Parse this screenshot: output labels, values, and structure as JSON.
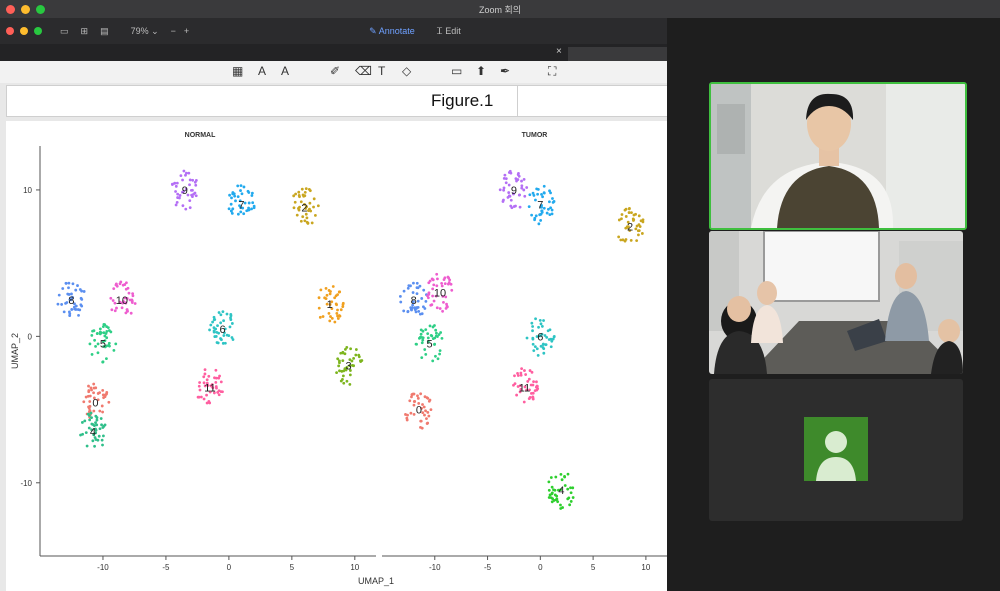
{
  "window": {
    "title": "Zoom 회의"
  },
  "toolbar": {
    "zoom_level": "79%",
    "annotate_label": "Annotate",
    "edit_label": "Edit"
  },
  "tab": {
    "close_glyph": "×"
  },
  "markup_icons": [
    "text-select-icon",
    "text-box-icon",
    "text-style-icon",
    "pen-icon",
    "eraser-icon",
    "text-icon",
    "shape-icon",
    "note-icon",
    "stamp-icon",
    "signature-icon",
    "fullscreen-icon"
  ],
  "figure": {
    "title": "Figure.1"
  },
  "chart_data": {
    "type": "scatter",
    "panels": [
      {
        "title": "NORMAL",
        "clusters": [
          {
            "label": "0",
            "color": "#f07a6f",
            "x": -10.6,
            "y": -4.5
          },
          {
            "label": "1",
            "color": "#f0a020",
            "x": 8.0,
            "y": 2.2
          },
          {
            "label": "2",
            "color": "#c9a620",
            "x": 6.0,
            "y": 8.8
          },
          {
            "label": "3",
            "color": "#7db51e",
            "x": 9.5,
            "y": -2.0
          },
          {
            "label": "4",
            "color": "#2fbf8a",
            "x": -10.8,
            "y": -6.5
          },
          {
            "label": "5",
            "color": "#2ecf86",
            "x": -10.0,
            "y": -0.5
          },
          {
            "label": "6",
            "color": "#2ec4c4",
            "x": -0.5,
            "y": 0.5
          },
          {
            "label": "7",
            "color": "#22aaee",
            "x": 1.0,
            "y": 9.0
          },
          {
            "label": "8",
            "color": "#5b8ff0",
            "x": -12.5,
            "y": 2.5
          },
          {
            "label": "9",
            "color": "#b46ff5",
            "x": -3.5,
            "y": 10.0
          },
          {
            "label": "10",
            "color": "#ee5ecf",
            "x": -8.5,
            "y": 2.5
          },
          {
            "label": "11",
            "color": "#ff5fa0",
            "x": -1.5,
            "y": -3.5
          }
        ]
      },
      {
        "title": "TUMOR",
        "clusters": [
          {
            "label": "0",
            "color": "#f07a6f",
            "x": -11.5,
            "y": -5.0
          },
          {
            "label": "2",
            "color": "#c9a620",
            "x": 8.5,
            "y": 7.5
          },
          {
            "label": "4",
            "color": "#2ecf2e",
            "x": 2.0,
            "y": -10.5
          },
          {
            "label": "5",
            "color": "#2ecf86",
            "x": -10.5,
            "y": -0.5
          },
          {
            "label": "6",
            "color": "#2ec4c4",
            "x": 0.0,
            "y": 0.0
          },
          {
            "label": "7",
            "color": "#22aaee",
            "x": 0.0,
            "y": 9.0
          },
          {
            "label": "8",
            "color": "#5b8ff0",
            "x": -12.0,
            "y": 2.5
          },
          {
            "label": "9",
            "color": "#b46ff5",
            "x": -2.5,
            "y": 10.0
          },
          {
            "label": "10",
            "color": "#ee5ecf",
            "x": -9.5,
            "y": 3.0
          },
          {
            "label": "11",
            "color": "#ff5fa0",
            "x": -1.5,
            "y": -3.5
          }
        ]
      }
    ],
    "xlabel": "UMAP_1",
    "ylabel": "UMAP_2",
    "xticks": [
      "-10",
      "-5",
      "0",
      "5",
      "10"
    ],
    "yticks": [
      "10",
      "0",
      "-10"
    ],
    "xlim": [
      -15,
      12
    ],
    "ylim": [
      -15,
      13
    ]
  },
  "participants": [
    {
      "kind": "video",
      "active_speaker": true,
      "accent": "#3fbf3f"
    },
    {
      "kind": "video",
      "active_speaker": false
    },
    {
      "kind": "avatar",
      "active_speaker": false,
      "avatar_color": "#3e8a2b"
    }
  ]
}
